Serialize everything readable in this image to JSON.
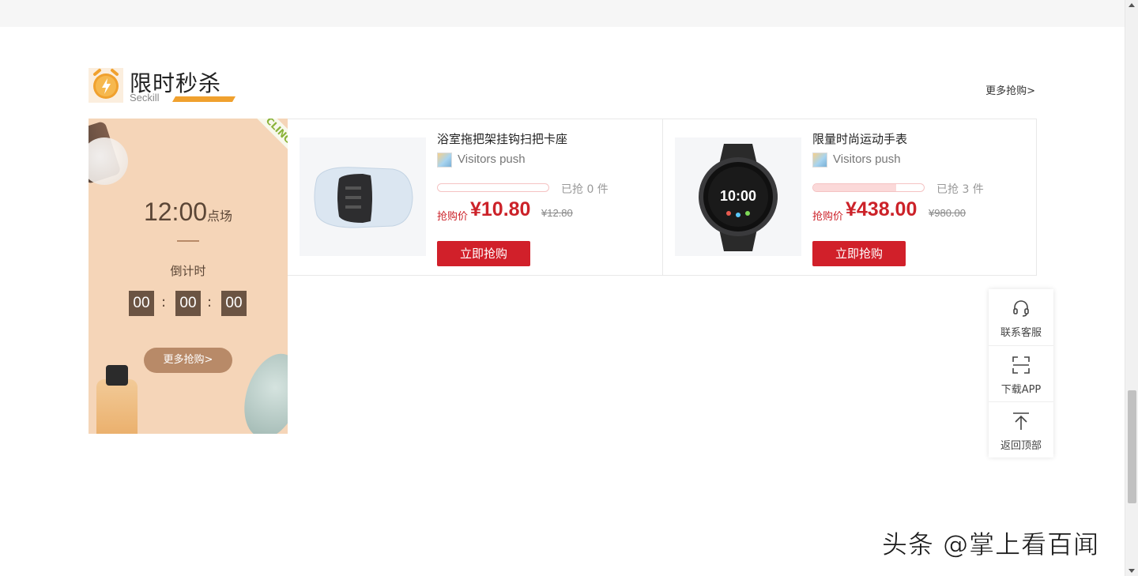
{
  "section": {
    "title": "限时秒杀",
    "subtitle": "Seckill",
    "more_link": "更多抢购>"
  },
  "promo": {
    "time": "12:00",
    "time_suffix": "点场",
    "countdown_label": "倒计时",
    "countdown": {
      "hours": "00",
      "minutes": "00",
      "seconds": "00"
    },
    "separator": ":",
    "more_button": "更多抢购>"
  },
  "products": [
    {
      "name": "浴室拖把架挂钩扫把卡座",
      "visitor": "Visitors push",
      "sold_progress": 0,
      "sold_text": "已抢 0 件",
      "price_label": "抢购价",
      "price": "¥10.80",
      "original_price": "¥12.80",
      "buy_button": "立即抢购"
    },
    {
      "name": "限量时尚运动手表",
      "visitor": "Visitors push",
      "sold_progress": 0.75,
      "sold_text": "已抢 3 件",
      "price_label": "抢购价",
      "price": "¥438.00",
      "original_price": "¥980.00",
      "buy_button": "立即抢购"
    }
  ],
  "sidebar": {
    "items": [
      {
        "label": "联系客服",
        "icon": "headset-icon"
      },
      {
        "label": "下载APP",
        "icon": "scan-icon"
      },
      {
        "label": "返回顶部",
        "icon": "back-to-top-icon"
      }
    ]
  },
  "watermark": "头条 @掌上看百闻",
  "colors": {
    "accent_red": "#d1202a",
    "accent_orange": "#f0a12e",
    "promo_bg": "#f5d5b8",
    "countdown_bg": "#6b5443"
  }
}
